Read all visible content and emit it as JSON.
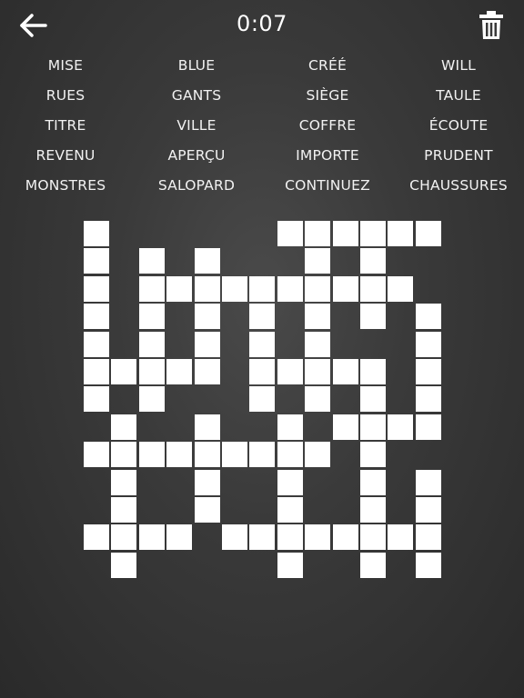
{
  "header": {
    "timer": "0:07",
    "back_icon": "arrow-left-icon",
    "trash_icon": "trash-icon"
  },
  "words": [
    [
      "MISE",
      "BLUE",
      "CRÉÉ",
      "WILL"
    ],
    [
      "RUES",
      "GANTS",
      "SIÈGE",
      "TAULE"
    ],
    [
      "TITRE",
      "VILLE",
      "COFFRE",
      "ÉCOUTE"
    ],
    [
      "REVENU",
      "APERÇU",
      "IMPORTE",
      "PRUDENT"
    ],
    [
      "MONSTRES",
      "SALOPARD",
      "CONTINUEZ",
      "CHAUSSURES"
    ]
  ],
  "grid": {
    "rows": 13,
    "cols": 13,
    "cells": [
      [
        0,
        0
      ],
      [
        0,
        7
      ],
      [
        0,
        8
      ],
      [
        0,
        9
      ],
      [
        0,
        10
      ],
      [
        0,
        11
      ],
      [
        0,
        12
      ],
      [
        1,
        0
      ],
      [
        1,
        2
      ],
      [
        1,
        4
      ],
      [
        1,
        8
      ],
      [
        1,
        10
      ],
      [
        2,
        0
      ],
      [
        2,
        2
      ],
      [
        2,
        3
      ],
      [
        2,
        4
      ],
      [
        2,
        5
      ],
      [
        2,
        6
      ],
      [
        2,
        7
      ],
      [
        2,
        8
      ],
      [
        2,
        9
      ],
      [
        2,
        10
      ],
      [
        2,
        11
      ],
      [
        3,
        0
      ],
      [
        3,
        2
      ],
      [
        3,
        4
      ],
      [
        3,
        6
      ],
      [
        3,
        8
      ],
      [
        3,
        10
      ],
      [
        3,
        12
      ],
      [
        4,
        0
      ],
      [
        4,
        2
      ],
      [
        4,
        4
      ],
      [
        4,
        6
      ],
      [
        4,
        8
      ],
      [
        4,
        12
      ],
      [
        5,
        0
      ],
      [
        5,
        1
      ],
      [
        5,
        2
      ],
      [
        5,
        3
      ],
      [
        5,
        4
      ],
      [
        5,
        6
      ],
      [
        5,
        7
      ],
      [
        5,
        8
      ],
      [
        5,
        9
      ],
      [
        5,
        10
      ],
      [
        5,
        12
      ],
      [
        6,
        0
      ],
      [
        6,
        2
      ],
      [
        6,
        6
      ],
      [
        6,
        8
      ],
      [
        6,
        10
      ],
      [
        6,
        12
      ],
      [
        7,
        1
      ],
      [
        7,
        4
      ],
      [
        7,
        7
      ],
      [
        7,
        9
      ],
      [
        7,
        10
      ],
      [
        7,
        11
      ],
      [
        7,
        12
      ],
      [
        8,
        0
      ],
      [
        8,
        1
      ],
      [
        8,
        2
      ],
      [
        8,
        3
      ],
      [
        8,
        4
      ],
      [
        8,
        5
      ],
      [
        8,
        6
      ],
      [
        8,
        7
      ],
      [
        8,
        8
      ],
      [
        8,
        10
      ],
      [
        9,
        1
      ],
      [
        9,
        4
      ],
      [
        9,
        7
      ],
      [
        9,
        10
      ],
      [
        9,
        12
      ],
      [
        10,
        1
      ],
      [
        10,
        4
      ],
      [
        10,
        7
      ],
      [
        10,
        10
      ],
      [
        10,
        12
      ],
      [
        11,
        0
      ],
      [
        11,
        1
      ],
      [
        11,
        2
      ],
      [
        11,
        3
      ],
      [
        11,
        5
      ],
      [
        11,
        6
      ],
      [
        11,
        7
      ],
      [
        11,
        8
      ],
      [
        11,
        9
      ],
      [
        11,
        10
      ],
      [
        11,
        11
      ],
      [
        11,
        12
      ],
      [
        12,
        1
      ],
      [
        12,
        7
      ],
      [
        12,
        10
      ],
      [
        12,
        12
      ]
    ]
  }
}
